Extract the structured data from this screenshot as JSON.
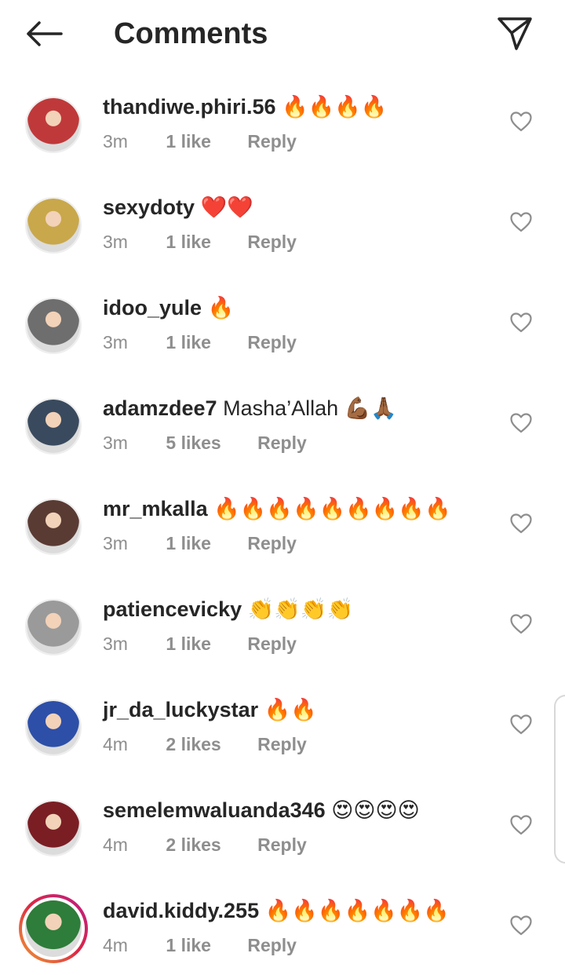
{
  "header": {
    "title": "Comments",
    "back_icon": "arrow-left-icon",
    "send_icon": "paper-plane-icon"
  },
  "comments": [
    {
      "username": "thandiwe.phiri.56",
      "text": "🔥🔥🔥🔥",
      "time": "3m",
      "likes": "1 like",
      "reply": "Reply",
      "avatar_color": "#c0393a"
    },
    {
      "username": "sexydoty",
      "text": "❤️❤️",
      "time": "3m",
      "likes": "1 like",
      "reply": "Reply",
      "avatar_color": "#c9a84b"
    },
    {
      "username": "idoo_yule",
      "text": "🔥",
      "time": "3m",
      "likes": "1 like",
      "reply": "Reply",
      "avatar_color": "#6e6e6e"
    },
    {
      "username": "adamzdee7",
      "text": "Masha’Allah 💪🏾🙏🏾",
      "time": "3m",
      "likes": "5 likes",
      "reply": "Reply",
      "avatar_color": "#3a4a5e"
    },
    {
      "username": "mr_mkalla",
      "text": "🔥🔥🔥🔥🔥🔥🔥🔥🔥",
      "time": "3m",
      "likes": "1 like",
      "reply": "Reply",
      "avatar_color": "#5a3b34"
    },
    {
      "username": "patiencevicky",
      "text": "👏👏👏👏",
      "time": "3m",
      "likes": "1 like",
      "reply": "Reply",
      "avatar_color": "#9a9a9a"
    },
    {
      "username": "jr_da_luckystar",
      "text": "🔥🔥",
      "time": "4m",
      "likes": "2 likes",
      "reply": "Reply",
      "avatar_color": "#2d4fa8"
    },
    {
      "username": "semelemwaluanda346",
      "text": "😍😍😍😍",
      "time": "4m",
      "likes": "2 likes",
      "reply": "Reply",
      "avatar_color": "#7a1e24"
    },
    {
      "username": "david.kiddy.255",
      "text": "🔥🔥🔥🔥🔥🔥🔥",
      "time": "4m",
      "likes": "1 like",
      "reply": "Reply",
      "avatar_color": "#2e7d3a",
      "story": true
    }
  ],
  "icons": {
    "heart": "heart-outline-icon"
  }
}
